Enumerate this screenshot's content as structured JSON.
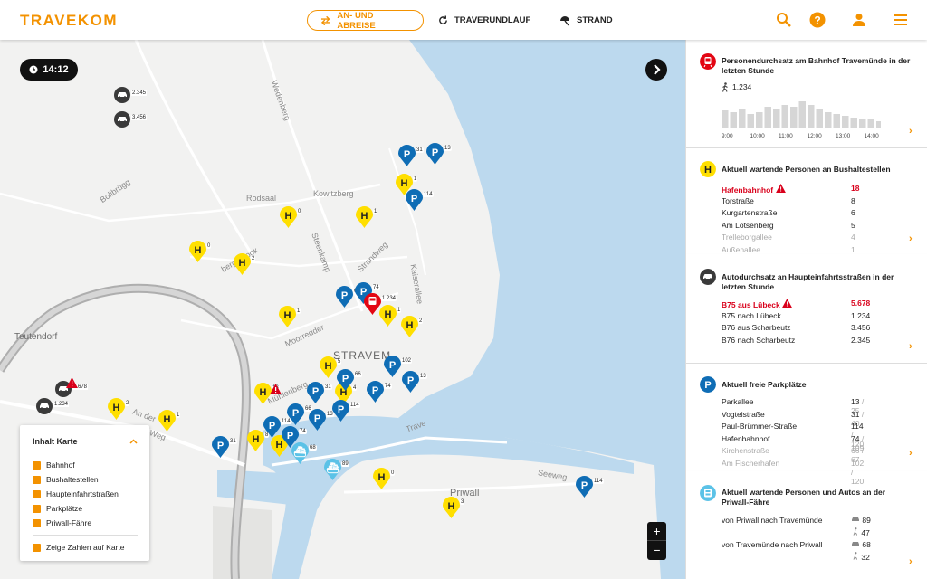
{
  "header": {
    "logo": "TRAVEKOM",
    "nav": [
      {
        "label": "AN- UND ABREISE",
        "active": true
      },
      {
        "label": "TRAVERUNDLAUF"
      },
      {
        "label": "STRAND"
      }
    ],
    "icons": [
      "search-icon",
      "help-icon",
      "user-icon",
      "menu-icon"
    ]
  },
  "map": {
    "time": "14:12",
    "places": [
      "Teutendorf",
      "STRAVEM",
      "Priwall",
      "Bollbrügg",
      "Rodsaal",
      "Kowitzberg",
      "Steenkamp",
      "Strandweg",
      "Moorredder",
      "Kaiserallee",
      "Seeweg",
      "An der",
      "Weg",
      "Wedenberg",
      "Trave",
      "Mühlenberg",
      "bergsbrook"
    ],
    "legend": {
      "title": "Inhalt Karte",
      "items": [
        "Bahnhof",
        "Bushaltestellen",
        "Haupteinfahrtstraßen",
        "Parkplätze",
        "Priwall-Fähre"
      ],
      "toggle": "Zeige Zahlen auf Karte"
    },
    "zoom": {
      "in": "+",
      "out": "−"
    }
  },
  "panel": {
    "train": {
      "title": "Personendurchsatz am Bahnhof Travemünde in der letzten Stunde",
      "count": "1.234",
      "ticks": [
        "9:00",
        "10:00",
        "11:00",
        "12:00",
        "13:00",
        "14:00"
      ]
    },
    "bus": {
      "title": "Aktuell wartende Personen an Bushaltestellen",
      "rows": [
        {
          "name": "Hafenbahnhof",
          "value": "18",
          "alert": true
        },
        {
          "name": "Torstraße",
          "value": "8"
        },
        {
          "name": "Kurgartenstraße",
          "value": "6"
        },
        {
          "name": "Am Lotsenberg",
          "value": "5"
        },
        {
          "name": "Trelleborgallee",
          "value": "4"
        },
        {
          "name": "Außenallee",
          "value": "1"
        }
      ]
    },
    "car": {
      "title": "Autodurchsatz an Haupteinfahrtsstraßen in der letzten Stunde",
      "rows": [
        {
          "name": "B75 aus Lübeck",
          "value": "5.678",
          "alert": true
        },
        {
          "name": "B75 nach Lübeck",
          "value": "1.234"
        },
        {
          "name": "B76 aus Scharbeutz",
          "value": "3.456"
        },
        {
          "name": "B76 nach Scharbeutz",
          "value": "2.345"
        }
      ]
    },
    "parking": {
      "title": "Aktuell freie Parkplätze",
      "rows": [
        {
          "name": "Parkallee",
          "value": "13",
          "total": "/ 25"
        },
        {
          "name": "Vogteistraße",
          "value": "31",
          "total": "/ 40"
        },
        {
          "name": "Paul-Brümmer-Straße",
          "value": "114",
          "total": "/ 120"
        },
        {
          "name": "Hafenbahnhof",
          "value": "74",
          "total": "/ 109"
        },
        {
          "name": "Kirchenstraße",
          "value": "66",
          "total": "/ 67"
        },
        {
          "name": "Am Fischerhafen",
          "value": "102",
          "total": "/ 120"
        }
      ]
    },
    "ferry": {
      "title": "Aktuell wartende Personen und Autos an der Priwall-Fähre",
      "rows": [
        {
          "name": "von Priwall nach Travemünde",
          "cars": "89",
          "people": "47"
        },
        {
          "name": "von Travemünde nach Priwall",
          "cars": "68",
          "people": "32"
        }
      ]
    }
  }
}
